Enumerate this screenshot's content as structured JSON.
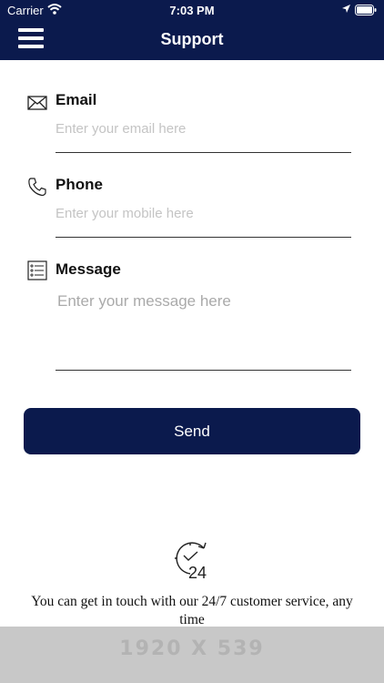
{
  "status_bar": {
    "carrier": "Carrier",
    "time": "7:03 PM"
  },
  "header": {
    "title": "Support",
    "menu_icon": "hamburger-icon"
  },
  "form": {
    "email": {
      "label": "Email",
      "placeholder": "Enter your email here",
      "value": "",
      "icon": "envelope-icon"
    },
    "phone": {
      "label": "Phone",
      "placeholder": "Enter your mobile here",
      "value": "",
      "icon": "phone-icon"
    },
    "message": {
      "label": "Message",
      "placeholder": "Enter your message here",
      "value": "",
      "icon": "list-icon"
    }
  },
  "send_button": {
    "label": "Send"
  },
  "footer": {
    "icon": "clock-24-icon",
    "text": "You can get in touch with our 24/7 customer service, any time"
  },
  "banner": {
    "text": "1920 X 539"
  },
  "colors": {
    "primary": "#0b1a4d",
    "background": "#ffffff",
    "placeholder": "#c4c4c4",
    "banner": "#c8c8c8"
  }
}
